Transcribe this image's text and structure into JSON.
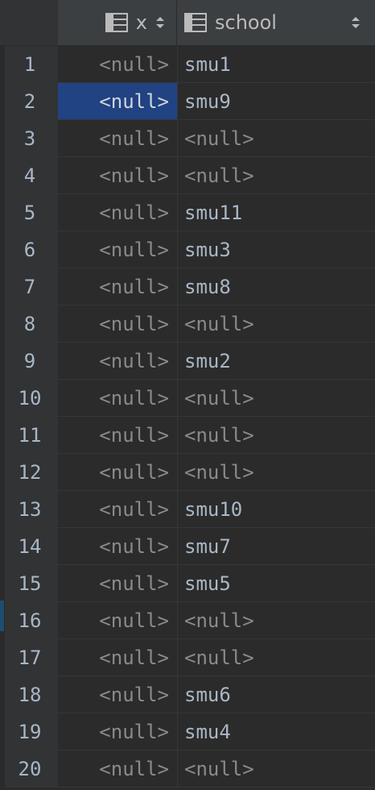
{
  "columns": {
    "x": {
      "label": "x",
      "icon": "table-column-icon",
      "sort_icon": "sort-updown-icon"
    },
    "school": {
      "label": "school",
      "icon": "table-column-icon",
      "sort_icon": "sort-updown-icon"
    }
  },
  "colors": {
    "background": "#2b2b2b",
    "header": "#3c3f41",
    "gutter": "#313335",
    "selection": "#214283",
    "null_text": "#8a8a8a",
    "value_text": "#a9b7c6"
  },
  "selected_row": 2,
  "rows": [
    {
      "num": "1",
      "x": "<null>",
      "school": "smu1"
    },
    {
      "num": "2",
      "x": "<null>",
      "school": "smu9"
    },
    {
      "num": "3",
      "x": "<null>",
      "school": "<null>"
    },
    {
      "num": "4",
      "x": "<null>",
      "school": "<null>"
    },
    {
      "num": "5",
      "x": "<null>",
      "school": "smu11"
    },
    {
      "num": "6",
      "x": "<null>",
      "school": "smu3"
    },
    {
      "num": "7",
      "x": "<null>",
      "school": "smu8"
    },
    {
      "num": "8",
      "x": "<null>",
      "school": "<null>"
    },
    {
      "num": "9",
      "x": "<null>",
      "school": "smu2"
    },
    {
      "num": "10",
      "x": "<null>",
      "school": "<null>"
    },
    {
      "num": "11",
      "x": "<null>",
      "school": "<null>"
    },
    {
      "num": "12",
      "x": "<null>",
      "school": "<null>"
    },
    {
      "num": "13",
      "x": "<null>",
      "school": "smu10"
    },
    {
      "num": "14",
      "x": "<null>",
      "school": "smu7"
    },
    {
      "num": "15",
      "x": "<null>",
      "school": "smu5"
    },
    {
      "num": "16",
      "x": "<null>",
      "school": "<null>"
    },
    {
      "num": "17",
      "x": "<null>",
      "school": "<null>"
    },
    {
      "num": "18",
      "x": "<null>",
      "school": "smu6"
    },
    {
      "num": "19",
      "x": "<null>",
      "school": "smu4"
    },
    {
      "num": "20",
      "x": "<null>",
      "school": "<null>"
    }
  ]
}
